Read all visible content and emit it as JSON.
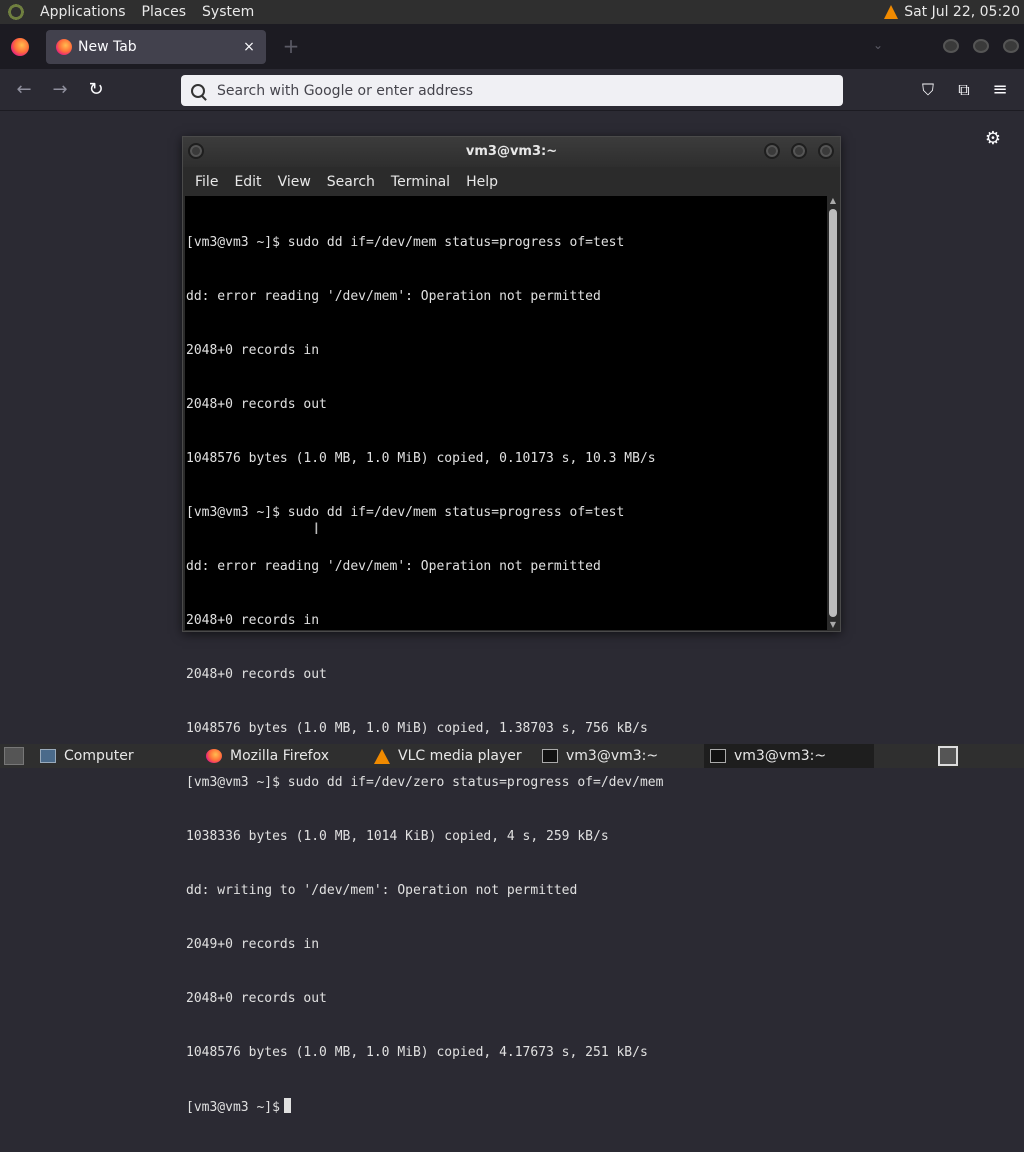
{
  "top_panel": {
    "menus": [
      "Applications",
      "Places",
      "System"
    ],
    "clock": "Sat Jul 22, 05:20"
  },
  "browser": {
    "tab_title": "New Tab",
    "tab_close": "×",
    "new_tab": "+",
    "url_placeholder": "Search with Google or enter address",
    "icons": {
      "back": "←",
      "forward": "→",
      "reload": "↻",
      "pocket": "⛉",
      "extensions": "⧉",
      "menu": "≡",
      "settings": "⚙"
    }
  },
  "terminal": {
    "title": "vm3@vm3:~",
    "menus": [
      "File",
      "Edit",
      "View",
      "Search",
      "Terminal",
      "Help"
    ],
    "lines": [
      "[vm3@vm3 ~]$ sudo dd if=/dev/mem status=progress of=test",
      "dd: error reading '/dev/mem': Operation not permitted",
      "2048+0 records in",
      "2048+0 records out",
      "1048576 bytes (1.0 MB, 1.0 MiB) copied, 0.10173 s, 10.3 MB/s",
      "[vm3@vm3 ~]$ sudo dd if=/dev/mem status=progress of=test",
      "dd: error reading '/dev/mem': Operation not permitted",
      "2048+0 records in",
      "2048+0 records out",
      "1048576 bytes (1.0 MB, 1.0 MiB) copied, 1.38703 s, 756 kB/s",
      "[vm3@vm3 ~]$ sudo dd if=/dev/zero status=progress of=/dev/mem",
      "1038336 bytes (1.0 MB, 1014 KiB) copied, 4 s, 259 kB/s",
      "dd: writing to '/dev/mem': Operation not permitted",
      "2049+0 records in",
      "2048+0 records out",
      "1048576 bytes (1.0 MB, 1.0 MiB) copied, 4.17673 s, 251 kB/s"
    ],
    "prompt": "[vm3@vm3 ~]$"
  },
  "taskbar": {
    "items": [
      "Computer",
      "Mozilla Firefox",
      "VLC media player",
      "vm3@vm3:~",
      "vm3@vm3:~"
    ]
  },
  "colors": {
    "panel_bg": "#2f2f2f",
    "firefox_bg": "#2b2a33",
    "terminal_bg": "#000000",
    "vlc_orange": "#f08a00"
  }
}
